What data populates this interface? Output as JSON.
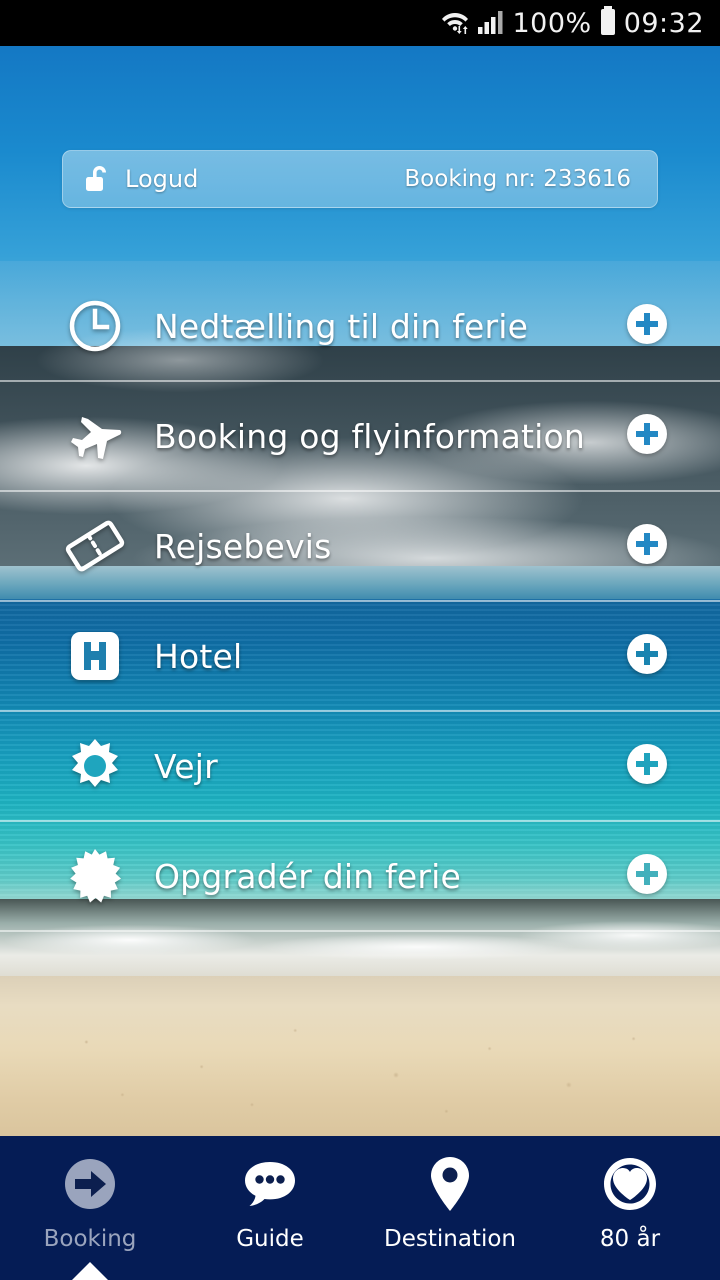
{
  "status_bar": {
    "battery_percent": "100%",
    "time": "09:32",
    "icons": [
      "wifi-transfer-icon",
      "signal-bars-icon",
      "battery-icon"
    ]
  },
  "login_bar": {
    "lock_icon": "unlocked-padlock-icon",
    "logout_label": "Logud",
    "booking_number": "Booking nr: 233616"
  },
  "menu": {
    "items": [
      {
        "icon": "clock-icon",
        "label": "Nedtælling til din ferie",
        "action": "plus-circle-icon"
      },
      {
        "icon": "airplane-icon",
        "label": "Booking og flyinformation",
        "action": "plus-circle-icon"
      },
      {
        "icon": "ticket-icon",
        "label": "Rejsebevis",
        "action": "plus-circle-icon"
      },
      {
        "icon": "hotel-h-icon",
        "label": "Hotel",
        "action": "plus-circle-icon"
      },
      {
        "icon": "sun-icon",
        "label": "Vejr",
        "action": "plus-circle-icon"
      },
      {
        "icon": "starburst-icon",
        "label": "Opgradér din ferie",
        "action": "plus-circle-icon"
      }
    ]
  },
  "bottom_nav": {
    "items": [
      {
        "icon": "arrow-right-circle-icon",
        "label": "Booking",
        "active": true
      },
      {
        "icon": "speech-bubble-icon",
        "label": "Guide",
        "active": false
      },
      {
        "icon": "map-pin-icon",
        "label": "Destination",
        "active": false
      },
      {
        "icon": "heart-swirl-icon",
        "label": "80 år",
        "active": false
      }
    ]
  },
  "colors": {
    "nav_background": "#051C55",
    "status_background": "#000000",
    "sky_blue": "#1A8ACE",
    "sea_teal": "#1EB3C2",
    "sand": "#E9D9B7",
    "inactive_label": "#9AA4BD"
  }
}
